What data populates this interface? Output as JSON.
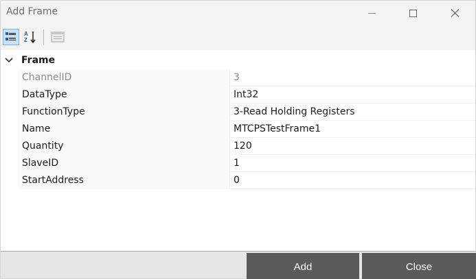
{
  "window": {
    "title": "Add Frame"
  },
  "toolbar": {
    "categorized_icon": "categorized-view-icon",
    "alphabetical_icon": "alphabetical-sort-icon",
    "property_pages_icon": "property-pages-icon"
  },
  "grid": {
    "category": {
      "label": "Frame",
      "expanded": true
    },
    "properties": [
      {
        "name": "ChannelID",
        "value": "3",
        "readonly": true
      },
      {
        "name": "DataType",
        "value": "Int32",
        "readonly": false
      },
      {
        "name": "FunctionType",
        "value": "3-Read Holding Registers",
        "readonly": false
      },
      {
        "name": "Name",
        "value": "MTCPSTestFrame1",
        "readonly": false
      },
      {
        "name": "Quantity",
        "value": "120",
        "readonly": false
      },
      {
        "name": "SlaveID",
        "value": "1",
        "readonly": false
      },
      {
        "name": "StartAddress",
        "value": "0",
        "readonly": false
      }
    ]
  },
  "footer": {
    "add_label": "Add",
    "close_label": "Close"
  },
  "colors": {
    "button_bg": "#5a5a5a",
    "selected_toolbar": "#c9e0f7"
  }
}
